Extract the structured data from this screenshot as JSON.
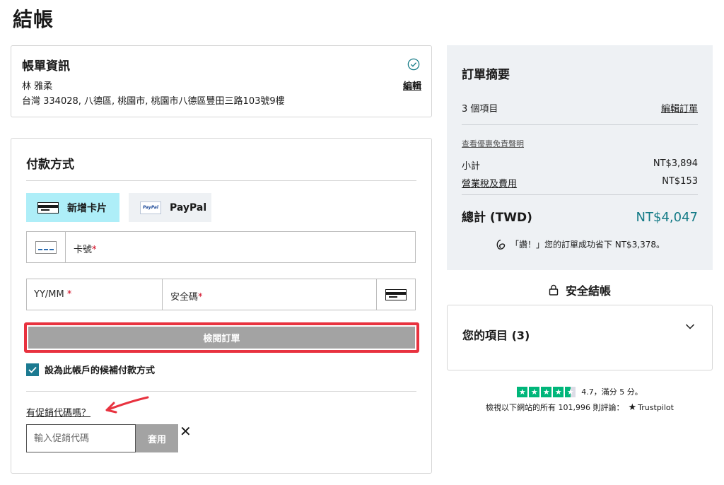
{
  "page": {
    "title": "結帳"
  },
  "billing": {
    "title": "帳單資訊",
    "name": "林 雅柔",
    "address": "台灣 334028, 八德區, 桃園市, 桃園市八德區豐田三路103號9樓",
    "edit_label": "編輯",
    "status_icon": "check-circle-icon"
  },
  "payment": {
    "title": "付款方式",
    "tabs": [
      {
        "label": "新增卡片",
        "icon": "credit-card-icon",
        "selected": true
      },
      {
        "label": "PayPal",
        "icon": "paypal-logo-icon",
        "selected": false
      }
    ],
    "card_number": {
      "label": "卡號",
      "required_mark": "*"
    },
    "expiry": {
      "label": "YY/MM",
      "required_mark": " *"
    },
    "cvc": {
      "label": "安全碼",
      "required_mark": "*"
    },
    "review_button": "檢閱訂單",
    "save_checkbox": {
      "label": "設為此帳戶的候補付款方式",
      "checked": true
    },
    "promo": {
      "link_label": "有促銷代碼嗎？",
      "placeholder": "輸入促銷代碼",
      "apply_label": "套用",
      "close_symbol": "✕"
    }
  },
  "summary": {
    "title": "訂單摘要",
    "item_count": "3 個項目",
    "edit_label": "編輯訂單",
    "disclaimer_link": "查看優惠免責聲明",
    "subtotal_label": "小計",
    "subtotal_value": "NT$3,894",
    "tax_label": "營業稅及費用",
    "tax_value": "NT$153",
    "total_label": "總計 (TWD)",
    "total_value": "NT$4,047",
    "savings_text": "「讚！」您的訂單成功省下 NT$3,378。"
  },
  "secure_checkout": {
    "label": "安全結帳"
  },
  "items": {
    "title": "您的項目 (3)"
  },
  "trustpilot": {
    "rating_text": "4.7，滿分 5 分。",
    "stars": 4.5,
    "reviews_text": "檢視以下網站的所有 101,996 則評論：",
    "brand": "Trustpilot"
  },
  "colors": {
    "accent_teal": "#137a86",
    "selected_tab": "#aeeef8",
    "highlight_red": "#e8323f",
    "trustpilot_green": "#00b67a",
    "summary_bg": "#eef1f4"
  }
}
